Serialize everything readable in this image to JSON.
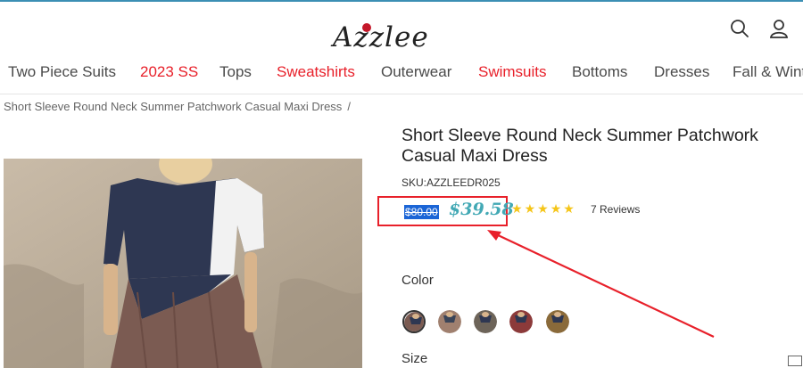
{
  "header": {
    "logo": "Azzlee",
    "icons": [
      "search-icon",
      "user-icon"
    ]
  },
  "nav": {
    "items": [
      {
        "label": "Two Piece Suits",
        "color": "#4a4a4a"
      },
      {
        "label": "2023 SS",
        "color": "#e8202a"
      },
      {
        "label": "Tops",
        "color": "#4a4a4a"
      },
      {
        "label": "Sweatshirts",
        "color": "#e8202a"
      },
      {
        "label": "Outerwear",
        "color": "#4a4a4a"
      },
      {
        "label": "Swimsuits",
        "color": "#e8202a"
      },
      {
        "label": "Bottoms",
        "color": "#4a4a4a"
      },
      {
        "label": "Dresses",
        "color": "#4a4a4a"
      },
      {
        "label": "Fall & Wint",
        "color": "#4a4a4a"
      }
    ]
  },
  "breadcrumb": {
    "current": "Short Sleeve Round Neck Summer Patchwork Casual Maxi Dress",
    "separator": "/"
  },
  "product": {
    "title": "Short Sleeve Round Neck Summer Patchwork\nCasual Maxi Dress",
    "sku": "SKU:AZZLEEDR025",
    "old_price": "$80.00",
    "new_price": "$39.58",
    "rating": 5,
    "reviews": "7 Reviews",
    "color_label": "Color",
    "size_label": "Size",
    "swatches": [
      {
        "name": "navy-brown",
        "selected": true
      },
      {
        "name": "navy-pink",
        "selected": false
      },
      {
        "name": "navy-grey",
        "selected": false
      },
      {
        "name": "navy-red",
        "selected": false
      },
      {
        "name": "navy-yellow",
        "selected": false
      }
    ]
  },
  "colors": {
    "accent": "#43a9b5",
    "sale_red": "#e8202a",
    "selection_blue": "#1b65d6",
    "star": "#f5c518"
  }
}
